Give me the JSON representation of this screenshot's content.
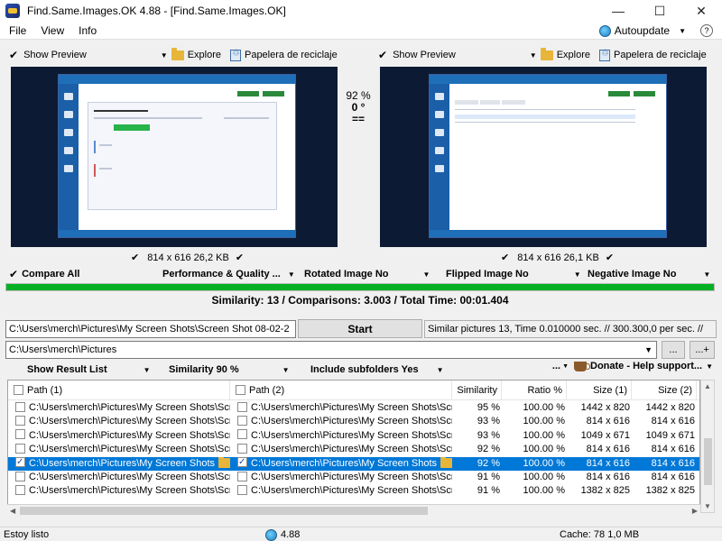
{
  "window": {
    "title": "Find.Same.Images.OK 4.88 - [Find.Same.Images.OK]"
  },
  "window_controls": {
    "minimize": "—",
    "maximize": "☐",
    "close": "✕"
  },
  "menu": {
    "items": [
      "File",
      "View",
      "Info"
    ],
    "autoupdate": "Autoupdate",
    "help": "?"
  },
  "left_preview": {
    "show_preview": "Show Preview",
    "explore": "Explore",
    "recycle": "Papelera de reciclaje",
    "dims": "814 x 616 26,2 KB"
  },
  "right_preview": {
    "show_preview": "Show Preview",
    "explore": "Explore",
    "recycle": "Papelera de reciclaje",
    "dims": "814 x 616 26,1 KB"
  },
  "compare": {
    "percent": "92 %",
    "rotation": "0 °",
    "equal": "=="
  },
  "options": {
    "compare_all": "Compare All",
    "performance": "Performance & Quality ...",
    "rotated": "Rotated Image No",
    "flipped": "Flipped Image No",
    "negative": "Negative Image No"
  },
  "progress": {
    "value": 1.0
  },
  "summary": "Similarity: 13 / Comparisons: 3.003 / Total Time: 00:01.404",
  "current_path": "C:\\Users\\merch\\Pictures\\My Screen Shots\\Screen Shot 08-02-2",
  "start_button": "Start",
  "status_line": "Similar pictures 13, Time 0.010000 sec. // 300.300,0 per sec. //",
  "folder": {
    "value": "C:\\Users\\merch\\Pictures",
    "browse": "...",
    "add": "...+"
  },
  "result_options": {
    "show_list": "Show Result List",
    "similarity": "Similarity 90 %",
    "subfolders": "Include subfolders Yes",
    "more": "...",
    "donate": "Donate - Help support..."
  },
  "table": {
    "headers": [
      "Path (1)",
      "Path (2)",
      "Similarity",
      "Ratio %",
      "Size (1)",
      "Size (2)"
    ],
    "rows": [
      {
        "p1": "C:\\Users\\merch\\Pictures\\My Screen Shots\\Scre...",
        "p2": "C:\\Users\\merch\\Pictures\\My Screen Shots\\Scre...",
        "sim": "95 %",
        "ratio": "100.00 %",
        "s1": "1442 x 820",
        "s2": "1442 x 820",
        "c1": false,
        "c2": false,
        "selected": false
      },
      {
        "p1": "C:\\Users\\merch\\Pictures\\My Screen Shots\\Scre...",
        "p2": "C:\\Users\\merch\\Pictures\\My Screen Shots\\Scre...",
        "sim": "93 %",
        "ratio": "100.00 %",
        "s1": "814 x 616",
        "s2": "814 x 616",
        "c1": false,
        "c2": false,
        "selected": false
      },
      {
        "p1": "C:\\Users\\merch\\Pictures\\My Screen Shots\\Scre...",
        "p2": "C:\\Users\\merch\\Pictures\\My Screen Shots\\Scre...",
        "sim": "93 %",
        "ratio": "100.00 %",
        "s1": "1049 x 671",
        "s2": "1049 x 671",
        "c1": false,
        "c2": false,
        "selected": false
      },
      {
        "p1": "C:\\Users\\merch\\Pictures\\My Screen Shots\\Scre...",
        "p2": "C:\\Users\\merch\\Pictures\\My Screen Shots\\Scre...",
        "sim": "92 %",
        "ratio": "100.00 %",
        "s1": "814 x 616",
        "s2": "814 x 616",
        "c1": false,
        "c2": false,
        "selected": false
      },
      {
        "p1": "C:\\Users\\merch\\Pictures\\My Screen Shots",
        "p2": "C:\\Users\\merch\\Pictures\\My Screen Shots",
        "sim": "92 %",
        "ratio": "100.00 %",
        "s1": "814 x 616",
        "s2": "814 x 616",
        "c1": true,
        "c2": true,
        "selected": true
      },
      {
        "p1": "C:\\Users\\merch\\Pictures\\My Screen Shots\\Scre...",
        "p2": "C:\\Users\\merch\\Pictures\\My Screen Shots\\Scre...",
        "sim": "91 %",
        "ratio": "100.00 %",
        "s1": "814 x 616",
        "s2": "814 x 616",
        "c1": false,
        "c2": false,
        "selected": false
      },
      {
        "p1": "C:\\Users\\merch\\Pictures\\My Screen Shots\\Scre...",
        "p2": "C:\\Users\\merch\\Pictures\\My Screen Shots\\Scre...",
        "sim": "91 %",
        "ratio": "100.00 %",
        "s1": "1382 x 825",
        "s2": "1382 x 825",
        "c1": false,
        "c2": false,
        "selected": false
      }
    ]
  },
  "statusbar": {
    "state": "Estoy listo",
    "version": "4.88",
    "cache": "Cache: 78 1,0 MB"
  },
  "colors": {
    "selection": "#0078d7",
    "progress": "#06b025",
    "preview_bg": "#0d1a33",
    "app_blue": "#1e6fb8"
  }
}
